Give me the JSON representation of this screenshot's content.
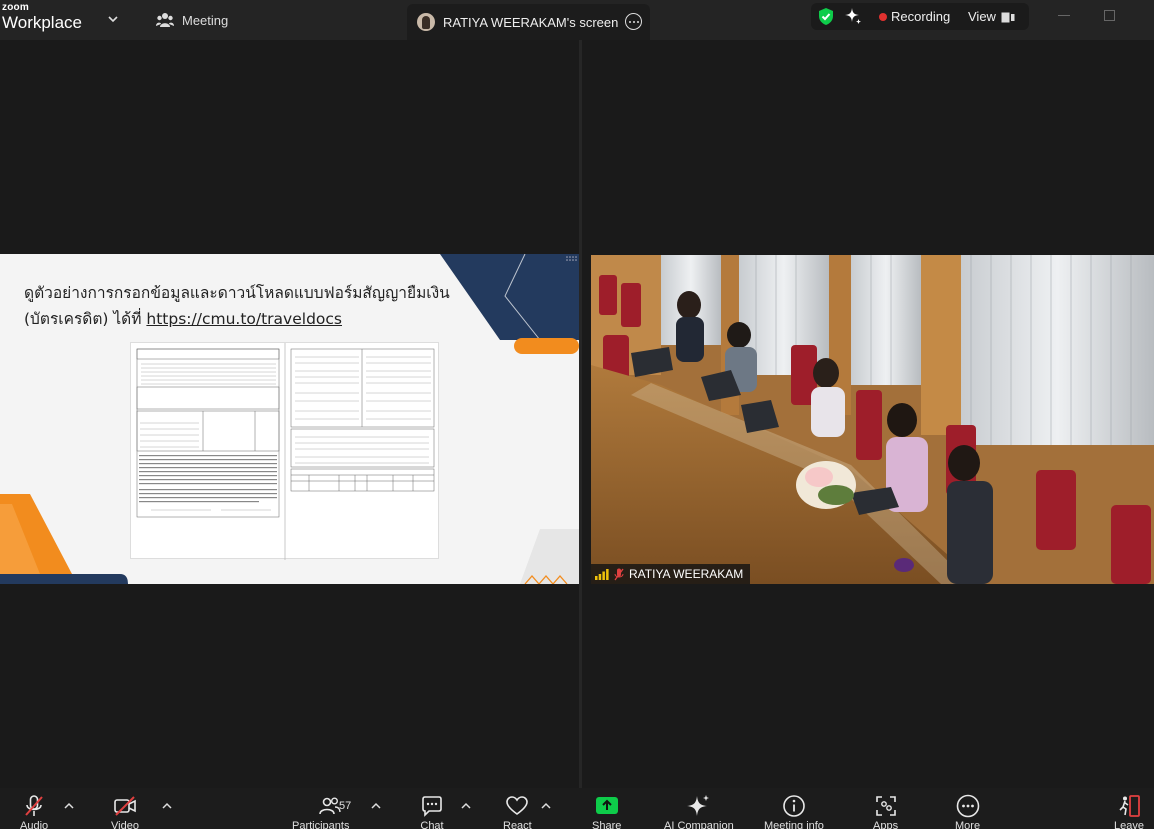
{
  "app": {
    "brand_top": "zoom",
    "brand_bottom": "Workplace"
  },
  "tabs": {
    "meeting": "Meeting",
    "share": "RATIYA WEERAKAM's screen"
  },
  "status": {
    "recording": "Recording",
    "view": "View"
  },
  "slide": {
    "title_line": "ดูตัวอย่างการกรอกข้อมูลและดาวน์โหลดแบบฟอร์มสัญญายืมเงิน",
    "title_line2_prefix": "(บัตรเครดิต) ได้ที่ ",
    "url": "https://cmu.to/traveldocs"
  },
  "video": {
    "participant_name": "RATIYA WEERAKAM"
  },
  "toolbar": {
    "audio": "Audio",
    "video": "Video",
    "participants": "Participants",
    "participants_count": "57",
    "chat": "Chat",
    "react": "React",
    "share": "Share",
    "ai_companion": "AI Companion",
    "meeting_info": "Meeting info",
    "apps": "Apps",
    "more": "More",
    "leave": "Leave"
  },
  "colors": {
    "accent_green": "#0ecc4a",
    "recording_red": "#e0312f",
    "muted_red": "#e04040",
    "slide_navy": "#233a5e",
    "slide_orange": "#f28c1e"
  }
}
